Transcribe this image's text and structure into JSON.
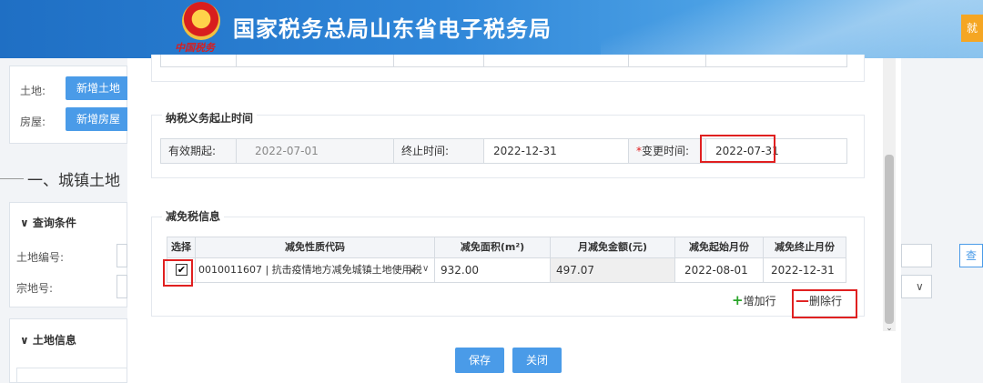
{
  "header": {
    "title": "国家税务总局山东省电子税务局",
    "emblem_caption": "中国税务",
    "right_button": "就"
  },
  "background": {
    "land_label": "土地:",
    "add_land_button": "新增土地",
    "house_label": "房屋:",
    "add_house_button": "新增房屋",
    "section_title": "一、城镇土地",
    "query_title": "查询条件",
    "land_no_label": "土地编号:",
    "parcel_no_label": "宗地号:",
    "land_info_title": "土地信息",
    "query_button": "查"
  },
  "tax_period": {
    "legend": "纳税义务起止时间",
    "start_label": "有效期起:",
    "start_value": "2022-07-01",
    "end_label": "终止时间:",
    "end_value": "2022-12-31",
    "change_label_req": "*",
    "change_label": "变更时间:",
    "change_value": "2022-07-31"
  },
  "relief": {
    "legend": "减免税信息",
    "columns": [
      "选择",
      "减免性质代码",
      "减免面积(m²)",
      "月减免金额(元)",
      "减免起始月份",
      "减免终止月份"
    ],
    "rows": [
      {
        "checked": "✔",
        "code": "0010011607 | 抗击疫情地方减免城镇土地使用税",
        "area": "932.00",
        "monthly_amount": "497.07",
        "start_month": "2022-08-01",
        "end_month": "2022-12-31"
      }
    ],
    "add_row": "增加行",
    "delete_row": "删除行"
  },
  "footer": {
    "save": "保存",
    "close": "关闭"
  },
  "colors": {
    "accent": "#4a9be8",
    "highlight": "#e02020"
  }
}
